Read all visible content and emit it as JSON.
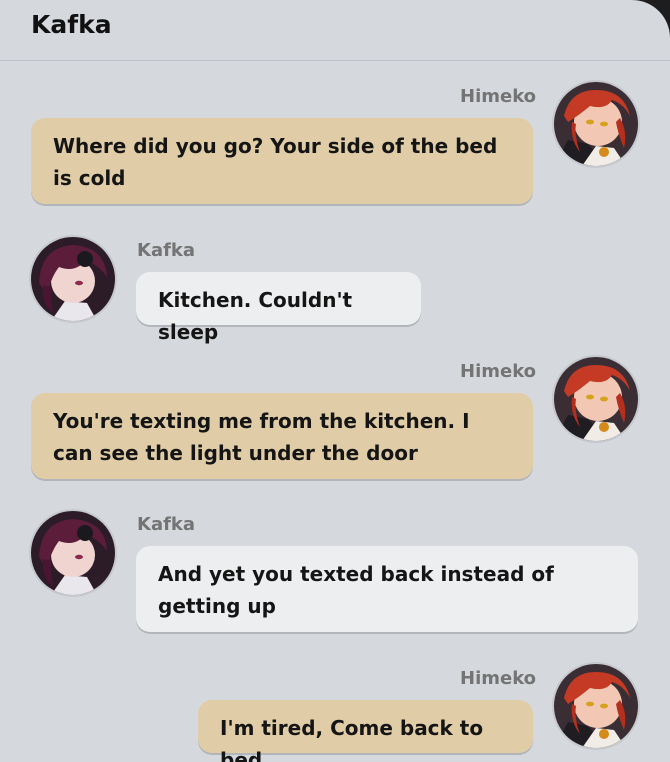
{
  "header": {
    "title": "Kafka"
  },
  "messages": [
    {
      "sender": "Himeko",
      "text": "Where did you go? Your side of the bed is cold"
    },
    {
      "sender": "Kafka",
      "text": "Kitchen. Couldn't sleep"
    },
    {
      "sender": "Himeko",
      "text": "You're texting me from the kitchen. I can see the light under the door"
    },
    {
      "sender": "Kafka",
      "text": "And yet you texted back instead of getting up"
    },
    {
      "sender": "Himeko",
      "text": "I'm tired, Come back to bed"
    }
  ],
  "colors": {
    "background": "#d5d9de",
    "outgoing_bubble": "#e0cda7",
    "incoming_bubble": "#eceef0",
    "himeko_hair": "#c43a24",
    "kafka_hair": "#5b1d3a"
  },
  "icons": {
    "himeko_avatar": "himeko-portrait",
    "kafka_avatar": "kafka-portrait"
  }
}
